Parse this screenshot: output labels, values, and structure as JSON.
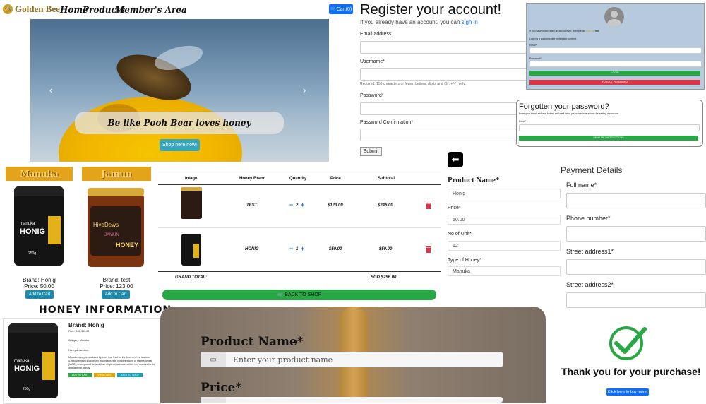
{
  "nav": {
    "brand": "Golden Bee",
    "links": [
      "Home",
      "Products",
      "Member's Area"
    ],
    "cart_label": "Cart(0)"
  },
  "hero": {
    "caption": "Be like Pooh Bear loves honey",
    "button": "Shop here now!"
  },
  "register": {
    "title": "Register your account!",
    "subtitle_prefix": "If you already have an account, you can",
    "signin_link": "sign in",
    "fields": {
      "email": "Email address",
      "username": "Username*",
      "username_help": "Required. 150 characters or fewer. Letters, digits and @/./+/-/_ only.",
      "password": "Password*",
      "password_confirm": "Password Confirmation*"
    },
    "submit": "Submit"
  },
  "login": {
    "line1": "If you have not created an account yet, then please",
    "signup_link": "sign up",
    "line1_end": "first.",
    "remember": "Login is a customizable boilerplate content.",
    "email_label": "Email*",
    "password_label": "Password*",
    "login_button": "LOGIN",
    "forgot_button": "FORGOT PASSWORD"
  },
  "forgot": {
    "title": "Forgotten your password?",
    "text": "Enter your email address below, and we'll send you some instructions for setting a new one.",
    "email_label": "Email*",
    "button": "SEND ME INSTRUCTIONS"
  },
  "products": [
    {
      "banner": "Manuka",
      "jar_brand": "manuka",
      "jar_name": "HONIG",
      "jar_weight": "250g",
      "brand": "Brand: Honig",
      "price": "Price: 50.00",
      "button": "Add to Cart"
    },
    {
      "banner": "Jamun",
      "jar_brand": "HiveDews",
      "jar_name": "HONEY",
      "jar_weight": "JAMUN",
      "brand": "Brand: test",
      "price": "Price: 123.00",
      "button": "Add to Cart"
    }
  ],
  "cart_table": {
    "headers": [
      "Image",
      "Honey Brand",
      "Quantity",
      "Price",
      "Subtotal"
    ],
    "rows": [
      {
        "brand": "TEST",
        "qty": "2",
        "price": "$123.00",
        "subtotal": "$246.00"
      },
      {
        "brand": "HONIG",
        "qty": "1",
        "price": "$50.00",
        "subtotal": "$50.00"
      }
    ],
    "total_label": "GRAND TOTAL:",
    "total_value": "SGD $296.00",
    "back_button": "BACK TO SHOP"
  },
  "product_form": {
    "title": "Product Name*",
    "name_value": "Honig",
    "price_label": "Price*",
    "price_value": "50.00",
    "units_label": "No of Unit*",
    "units_value": "12",
    "type_label": "Type of Honey*",
    "type_value": "Manuka"
  },
  "payment": {
    "title": "Payment Details",
    "fields": [
      "Full name*",
      "Phone number*",
      "Street address1*",
      "Street address2*"
    ]
  },
  "honey_info": {
    "title": "HONEY INFORMATION",
    "brand": "Brand: Honig",
    "price": "Price: SGD $50.00",
    "category": "Category: Manuka",
    "desc_label": "Honey description:",
    "desc": "Manuka honey is produced by bees that feed on the flowers of the tea tree (Leptospermum scoparium). It contains high concentrations of methylglyoxal (MGO), a compound derived from dihydroxyacetone, which may account for its antibacterial activity.",
    "buttons": [
      "ADD TO CART",
      "VIEW CART",
      "BACK TO SHOP"
    ]
  },
  "big_form": {
    "product_label": "Product Name*",
    "product_placeholder": "Enter your product name",
    "price_label": "Price*"
  },
  "thankyou": {
    "text": "Thank you for your purchase!",
    "button": "Click here to buy more!"
  },
  "colors": {
    "primary": "#0d6efd",
    "success": "#28a745",
    "danger": "#dc3545",
    "honey": "#e3a41a"
  }
}
